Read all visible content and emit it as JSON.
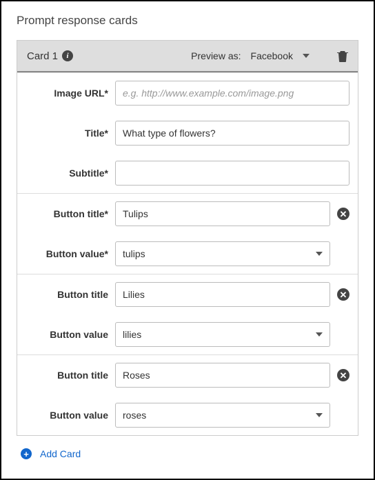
{
  "section_title": "Prompt response cards",
  "card": {
    "name": "Card 1",
    "preview": {
      "label": "Preview as:",
      "value": "Facebook"
    },
    "fields": {
      "image_url": {
        "label": "Image URL*",
        "value": "",
        "placeholder": "e.g. http://www.example.com/image.png"
      },
      "title": {
        "label": "Title*",
        "value": "What type of flowers?"
      },
      "subtitle": {
        "label": "Subtitle*",
        "value": ""
      }
    },
    "buttons": [
      {
        "title_label": "Button title*",
        "title_value": "Tulips",
        "value_label": "Button value*",
        "value_value": "tulips"
      },
      {
        "title_label": "Button title",
        "title_value": "Lilies",
        "value_label": "Button value",
        "value_value": "lilies"
      },
      {
        "title_label": "Button title",
        "title_value": "Roses",
        "value_label": "Button value",
        "value_value": "roses"
      }
    ]
  },
  "add_card_label": "Add Card"
}
